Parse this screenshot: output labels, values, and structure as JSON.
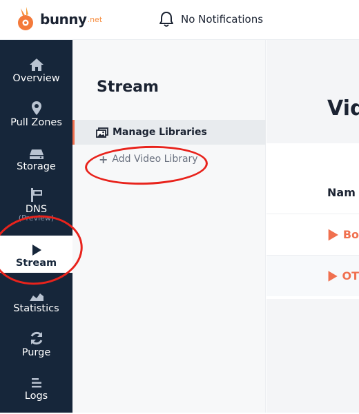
{
  "header": {
    "logo_text": "bunny",
    "logo_suffix": ".net",
    "notifications_label": "No Notifications"
  },
  "sidebar": {
    "items": [
      {
        "label": "Overview",
        "icon": "home-icon"
      },
      {
        "label": "Pull Zones",
        "icon": "map-pin-icon"
      },
      {
        "label": "Storage",
        "icon": "hard-drive-icon"
      },
      {
        "label": "DNS",
        "sub": "(Preview)",
        "icon": "signpost-icon"
      },
      {
        "label": "Stream",
        "icon": "play-icon",
        "active": true
      },
      {
        "label": "Statistics",
        "icon": "chart-icon"
      },
      {
        "label": "Purge",
        "icon": "refresh-icon"
      },
      {
        "label": "Logs",
        "icon": "list-icon"
      }
    ]
  },
  "subpanel": {
    "title": "Stream",
    "manage_label": "Manage Libraries",
    "add_label": "Add Video Library"
  },
  "main": {
    "title": "Vid",
    "column_header": "Nam",
    "rows": [
      {
        "name": "Bo"
      },
      {
        "name": "OT"
      }
    ]
  },
  "colors": {
    "sidebar_bg": "#16263a",
    "accent": "#f0704f",
    "annotation": "#e8231c"
  }
}
